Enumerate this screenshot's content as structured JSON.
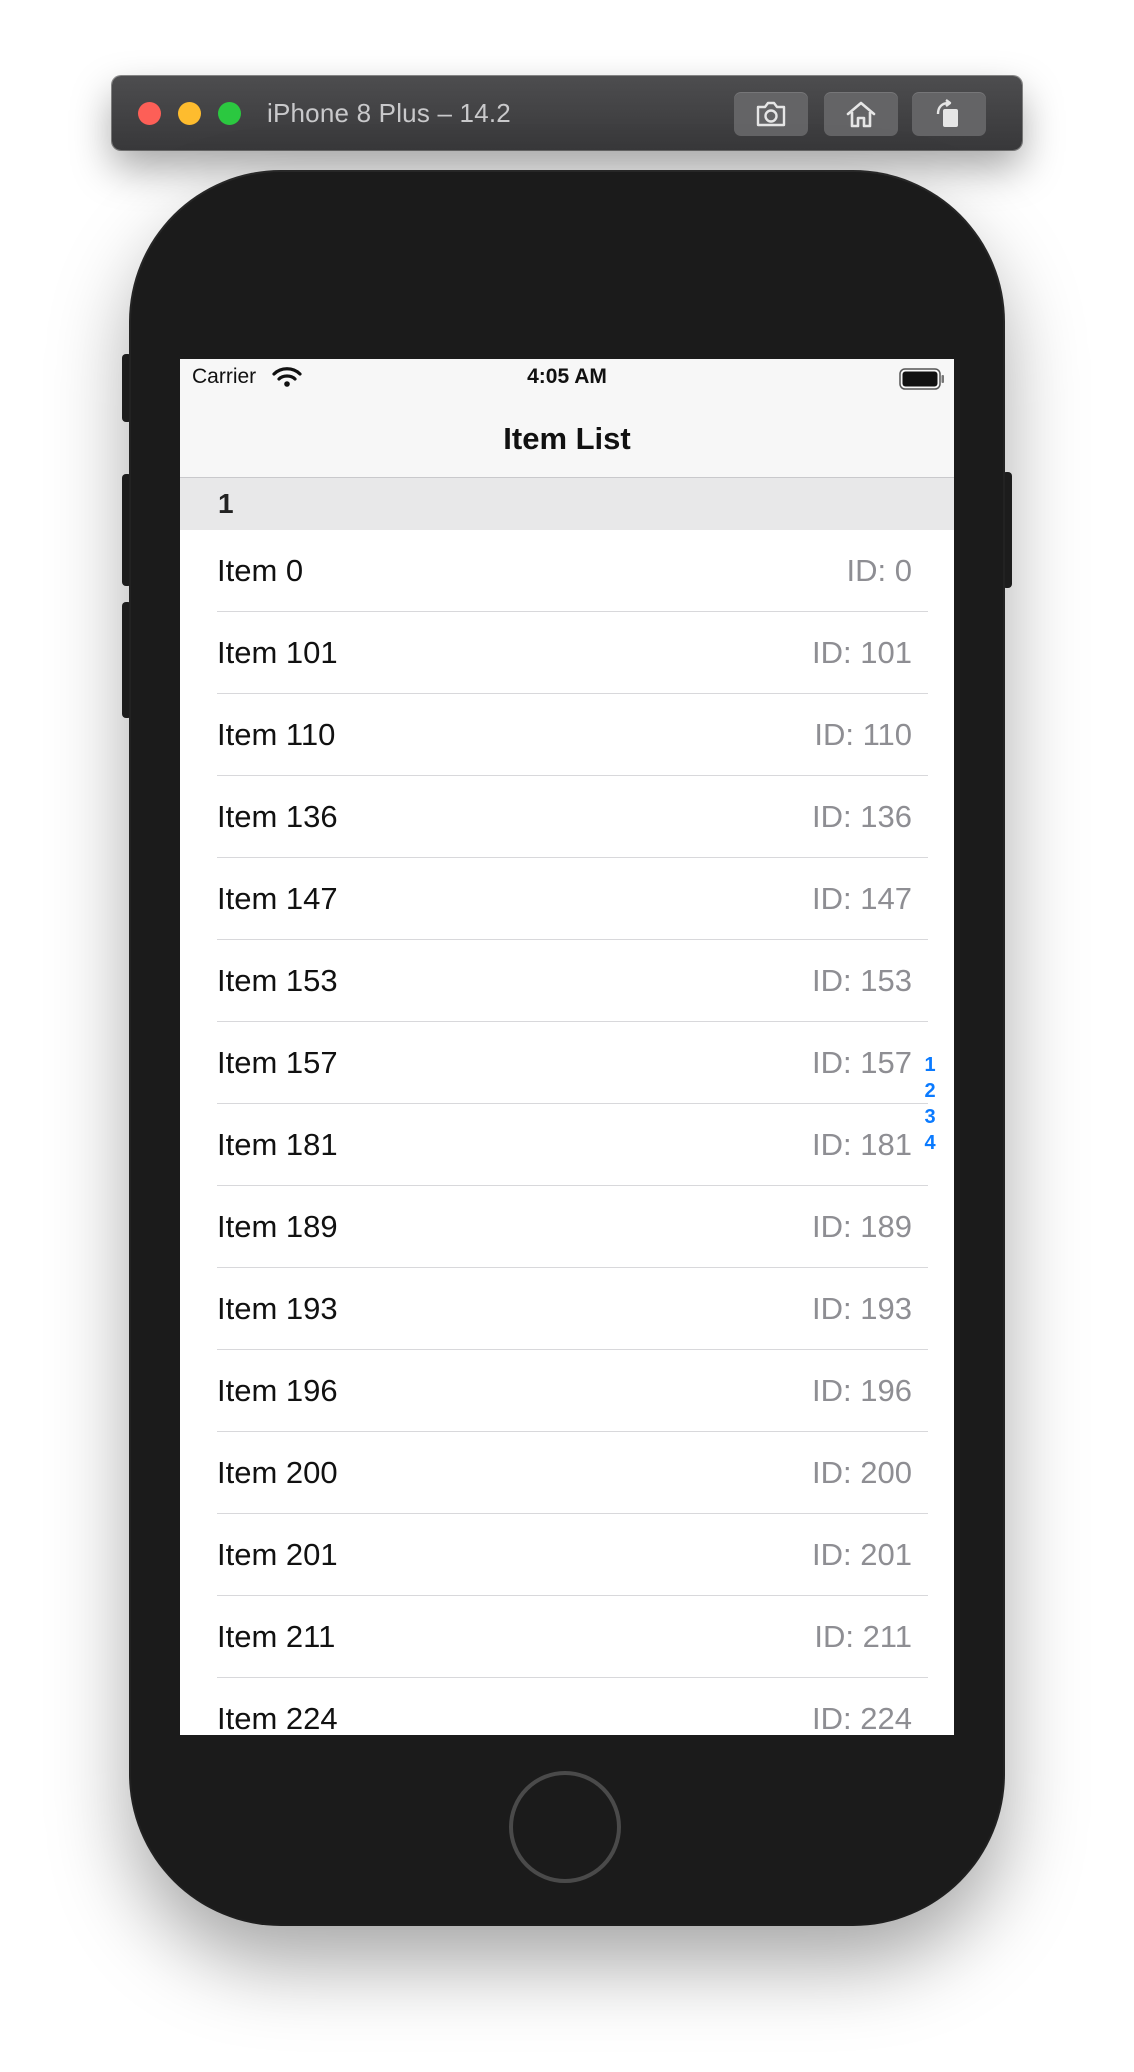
{
  "simulator": {
    "title": "iPhone 8 Plus – 14.2",
    "buttons": {
      "screenshot_icon": "camera-icon",
      "home_icon": "house-icon",
      "rotate_icon": "rotate-icon"
    }
  },
  "status_bar": {
    "carrier": "Carrier",
    "time": "4:05 AM",
    "wifi_icon": "wifi-icon",
    "battery_icon": "battery-icon"
  },
  "nav": {
    "title": "Item List"
  },
  "section": {
    "header": "1"
  },
  "items": [
    {
      "title": "Item 0",
      "detail": "ID: 0"
    },
    {
      "title": "Item 101",
      "detail": "ID: 101"
    },
    {
      "title": "Item 110",
      "detail": "ID: 110"
    },
    {
      "title": "Item 136",
      "detail": "ID: 136"
    },
    {
      "title": "Item 147",
      "detail": "ID: 147"
    },
    {
      "title": "Item 153",
      "detail": "ID: 153"
    },
    {
      "title": "Item 157",
      "detail": "ID: 157"
    },
    {
      "title": "Item 181",
      "detail": "ID: 181"
    },
    {
      "title": "Item 189",
      "detail": "ID: 189"
    },
    {
      "title": "Item 193",
      "detail": "ID: 193"
    },
    {
      "title": "Item 196",
      "detail": "ID: 196"
    },
    {
      "title": "Item 200",
      "detail": "ID: 200"
    },
    {
      "title": "Item 201",
      "detail": "ID: 201"
    },
    {
      "title": "Item 211",
      "detail": "ID: 211"
    },
    {
      "title": "Item 224",
      "detail": "ID: 224"
    }
  ],
  "section_index": [
    "1",
    "2",
    "3",
    "4"
  ],
  "colors": {
    "accent": "#0a7aff",
    "detail_text": "#8e8e93",
    "section_header_bg": "#e8e8e9"
  }
}
